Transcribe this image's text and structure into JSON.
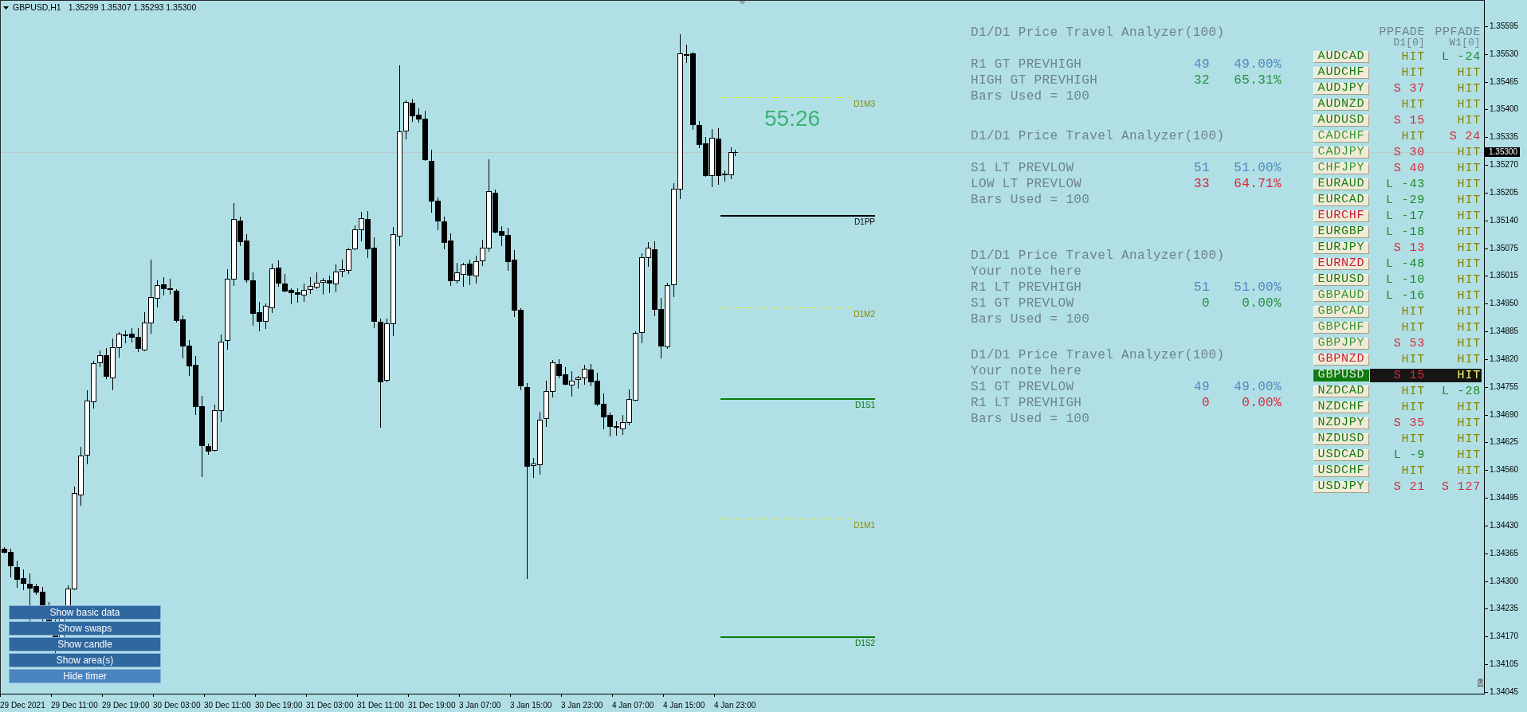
{
  "chart_header": {
    "symbol": "GBPUSD,H1",
    "ohlc": "1.35299 1.35307 1.35293 1.35300"
  },
  "timer": "55:26",
  "levels": [
    {
      "label": "D1M3",
      "kind": "mid"
    },
    {
      "label": "D1PP",
      "kind": "pivot"
    },
    {
      "label": "D1M2",
      "kind": "mid"
    },
    {
      "label": "D1S1",
      "kind": "support"
    },
    {
      "label": "D1M1",
      "kind": "mid"
    },
    {
      "label": "D1S2",
      "kind": "support"
    }
  ],
  "analyzers": [
    {
      "title": "D1/D1 Price Travel Analyzer(100)",
      "rows": [
        {
          "label": "R1 GT PREVHIGH",
          "count": "49",
          "percent": "49.00%",
          "color": "#4f86c0"
        },
        {
          "label": "HIGH GT PREVHIGH",
          "count": "32",
          "percent": "65.31%",
          "color": "#23913a"
        }
      ],
      "footer": "Bars Used = 100"
    },
    {
      "title": "D1/D1 Price Travel Analyzer(100)",
      "rows": [
        {
          "label": "S1 LT PREVLOW",
          "count": "51",
          "percent": "51.00%",
          "color": "#4f86c0"
        },
        {
          "label": "LOW LT PREVLOW",
          "count": "33",
          "percent": "64.71%",
          "color": "#e0213a"
        }
      ],
      "footer": "Bars Used = 100"
    },
    {
      "title": "D1/D1 Price Travel Analyzer(100)",
      "note": "Your note here",
      "rows": [
        {
          "label": "R1 LT PREVHIGH",
          "count": "51",
          "percent": "51.00%",
          "color": "#4f86c0"
        },
        {
          "label": "S1 GT PREVLOW",
          "count": "0",
          "percent": "0.00%",
          "color": "#23913a"
        }
      ],
      "footer": "Bars Used = 100"
    },
    {
      "title": "D1/D1 Price Travel Analyzer(100)",
      "note": "Your note here",
      "rows": [
        {
          "label": "S1 GT PREVLOW",
          "count": "49",
          "percent": "49.00%",
          "color": "#4f86c0"
        },
        {
          "label": "R1 LT PREVHIGH",
          "count": "0",
          "percent": "0.00%",
          "color": "#e0213a"
        }
      ],
      "footer": "Bars Used = 100"
    }
  ],
  "ppfade_table": {
    "columns": [
      {
        "title": "PPFADE",
        "period": "D1[0]"
      },
      {
        "title": "PPFADE",
        "period": "W1[0]"
      }
    ],
    "rows": [
      {
        "pair": "AUDCAD",
        "color": "#1b7b1b",
        "selected": false,
        "signals": [
          {
            "text": "HIT",
            "kind": "hit"
          },
          {
            "text": "L -24",
            "kind": "long"
          }
        ]
      },
      {
        "pair": "AUDCHF",
        "color": "#1b7b1b",
        "selected": false,
        "signals": [
          {
            "text": "HIT",
            "kind": "hit"
          },
          {
            "text": "HIT",
            "kind": "hit"
          }
        ]
      },
      {
        "pair": "AUDJPY",
        "color": "#1b7b1b",
        "selected": false,
        "signals": [
          {
            "text": "S 37",
            "kind": "short"
          },
          {
            "text": "HIT",
            "kind": "hit"
          }
        ]
      },
      {
        "pair": "AUDNZD",
        "color": "#1b7b1b",
        "selected": false,
        "signals": [
          {
            "text": "HIT",
            "kind": "hit"
          },
          {
            "text": "HIT",
            "kind": "hit"
          }
        ]
      },
      {
        "pair": "AUDUSD",
        "color": "#1b7b1b",
        "selected": false,
        "signals": [
          {
            "text": "S 15",
            "kind": "short"
          },
          {
            "text": "HIT",
            "kind": "hit"
          }
        ]
      },
      {
        "pair": "CADCHF",
        "color": "#3c963c",
        "selected": false,
        "signals": [
          {
            "text": "HIT",
            "kind": "hit"
          },
          {
            "text": "S 24",
            "kind": "short"
          }
        ]
      },
      {
        "pair": "CADJPY",
        "color": "#3c963c",
        "selected": false,
        "signals": [
          {
            "text": "S 30",
            "kind": "short"
          },
          {
            "text": "HIT",
            "kind": "hit"
          }
        ]
      },
      {
        "pair": "CHFJPY",
        "color": "#3c963c",
        "selected": false,
        "signals": [
          {
            "text": "S 40",
            "kind": "short"
          },
          {
            "text": "HIT",
            "kind": "hit"
          }
        ]
      },
      {
        "pair": "EURAUD",
        "color": "#1b7b1b",
        "selected": false,
        "signals": [
          {
            "text": "L -43",
            "kind": "long"
          },
          {
            "text": "HIT",
            "kind": "hit"
          }
        ]
      },
      {
        "pair": "EURCAD",
        "color": "#1b7b1b",
        "selected": false,
        "signals": [
          {
            "text": "L -29",
            "kind": "long"
          },
          {
            "text": "HIT",
            "kind": "hit"
          }
        ]
      },
      {
        "pair": "EURCHF",
        "color": "#c81e3c",
        "selected": false,
        "signals": [
          {
            "text": "L -17",
            "kind": "long"
          },
          {
            "text": "HIT",
            "kind": "hit"
          }
        ]
      },
      {
        "pair": "EURGBP",
        "color": "#1b7b1b",
        "selected": false,
        "signals": [
          {
            "text": "L -18",
            "kind": "long"
          },
          {
            "text": "HIT",
            "kind": "hit"
          }
        ]
      },
      {
        "pair": "EURJPY",
        "color": "#1b7b1b",
        "selected": false,
        "signals": [
          {
            "text": "S 13",
            "kind": "short"
          },
          {
            "text": "HIT",
            "kind": "hit"
          }
        ]
      },
      {
        "pair": "EURNZD",
        "color": "#c81e3c",
        "selected": false,
        "signals": [
          {
            "text": "L -48",
            "kind": "long"
          },
          {
            "text": "HIT",
            "kind": "hit"
          }
        ]
      },
      {
        "pair": "EURUSD",
        "color": "#1b7b1b",
        "selected": false,
        "signals": [
          {
            "text": "L -10",
            "kind": "long"
          },
          {
            "text": "HIT",
            "kind": "hit"
          }
        ]
      },
      {
        "pair": "GBPAUD",
        "color": "#3c963c",
        "selected": false,
        "signals": [
          {
            "text": "L -16",
            "kind": "long"
          },
          {
            "text": "HIT",
            "kind": "hit"
          }
        ]
      },
      {
        "pair": "GBPCAD",
        "color": "#3c963c",
        "selected": false,
        "signals": [
          {
            "text": "HIT",
            "kind": "hit"
          },
          {
            "text": "HIT",
            "kind": "hit"
          }
        ]
      },
      {
        "pair": "GBPCHF",
        "color": "#3c963c",
        "selected": false,
        "signals": [
          {
            "text": "HIT",
            "kind": "hit"
          },
          {
            "text": "HIT",
            "kind": "hit"
          }
        ]
      },
      {
        "pair": "GBPJPY",
        "color": "#3c963c",
        "selected": false,
        "signals": [
          {
            "text": "S 53",
            "kind": "short"
          },
          {
            "text": "HIT",
            "kind": "hit"
          }
        ]
      },
      {
        "pair": "GBPNZD",
        "color": "#c81e3c",
        "selected": false,
        "signals": [
          {
            "text": "HIT",
            "kind": "hit"
          },
          {
            "text": "HIT",
            "kind": "hit"
          }
        ]
      },
      {
        "pair": "GBPUSD",
        "color": "#0f7a0f",
        "selected": true,
        "signals": [
          {
            "text": "S 15",
            "kind": "short"
          },
          {
            "text": "HIT",
            "kind": "hit"
          }
        ]
      },
      {
        "pair": "NZDCAD",
        "color": "#1b7b1b",
        "selected": false,
        "signals": [
          {
            "text": "HIT",
            "kind": "hit"
          },
          {
            "text": "L -28",
            "kind": "long"
          }
        ]
      },
      {
        "pair": "NZDCHF",
        "color": "#1b7b1b",
        "selected": false,
        "signals": [
          {
            "text": "HIT",
            "kind": "hit"
          },
          {
            "text": "HIT",
            "kind": "hit"
          }
        ]
      },
      {
        "pair": "NZDJPY",
        "color": "#1b7b1b",
        "selected": false,
        "signals": [
          {
            "text": "S 35",
            "kind": "short"
          },
          {
            "text": "HIT",
            "kind": "hit"
          }
        ]
      },
      {
        "pair": "NZDUSD",
        "color": "#1b7b1b",
        "selected": false,
        "signals": [
          {
            "text": "HIT",
            "kind": "hit"
          },
          {
            "text": "HIT",
            "kind": "hit"
          }
        ]
      },
      {
        "pair": "USDCAD",
        "color": "#1b7b1b",
        "selected": false,
        "signals": [
          {
            "text": "L -9",
            "kind": "long"
          },
          {
            "text": "HIT",
            "kind": "hit"
          }
        ]
      },
      {
        "pair": "USDCHF",
        "color": "#1b7b1b",
        "selected": false,
        "signals": [
          {
            "text": "HIT",
            "kind": "hit"
          },
          {
            "text": "HIT",
            "kind": "hit"
          }
        ]
      },
      {
        "pair": "USDJPY",
        "color": "#1b7b1b",
        "selected": false,
        "signals": [
          {
            "text": "S 21",
            "kind": "short"
          },
          {
            "text": "S 127",
            "kind": "short"
          }
        ]
      }
    ]
  },
  "buttons": [
    {
      "label": "Show basic data",
      "active": false
    },
    {
      "label": "Show swaps",
      "active": false
    },
    {
      "label": "Show candle",
      "active": false
    },
    {
      "label": "Show area(s)",
      "active": false
    },
    {
      "label": "Hide timer",
      "active": true
    }
  ],
  "price_axis": {
    "labels": [
      "1.35595",
      "1.35530",
      "1.35465",
      "1.35400",
      "1.35335",
      "1.35270",
      "1.35205",
      "1.35140",
      "1.35075",
      "1.35015",
      "1.34950",
      "1.34885",
      "1.34820",
      "1.34755",
      "1.34690",
      "1.34625",
      "1.34560",
      "1.34495",
      "1.34430",
      "1.34365",
      "1.34300",
      "1.34235",
      "1.34170",
      "1.34105",
      "1.34045"
    ],
    "current_price": "1.35300"
  },
  "time_axis": {
    "labels": [
      "29 Dec 2021",
      "29 Dec 11:00",
      "29 Dec 19:00",
      "30 Dec 03:00",
      "30 Dec 11:00",
      "30 Dec 19:00",
      "31 Dec 03:00",
      "31 Dec 11:00",
      "31 Dec 19:00",
      "3 Jan 07:00",
      "3 Jan 15:00",
      "3 Jan 23:00",
      "4 Jan 07:00",
      "4 Jan 15:00",
      "4 Jan 23:00"
    ]
  }
}
